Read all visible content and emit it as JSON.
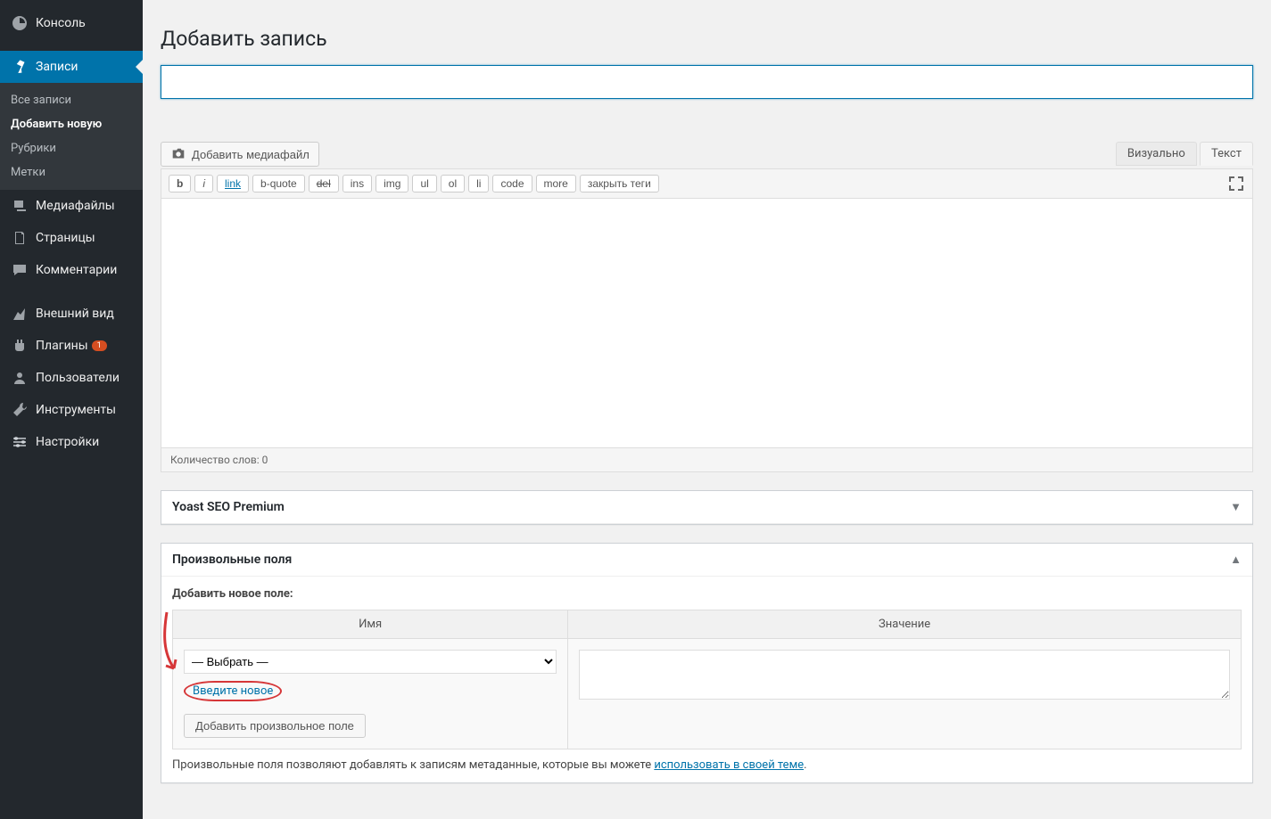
{
  "sidebar": {
    "console": "Консоль",
    "posts": "Записи",
    "posts_sub": {
      "all": "Все записи",
      "add": "Добавить новую",
      "categories": "Рубрики",
      "tags": "Метки"
    },
    "media": "Медиафайлы",
    "pages": "Страницы",
    "comments": "Комментарии",
    "appearance": "Внешний вид",
    "plugins": "Плагины",
    "plugins_badge": "1",
    "users": "Пользователи",
    "tools": "Инструменты",
    "settings": "Настройки"
  },
  "page": {
    "title": "Добавить запись",
    "add_media": "Добавить медиафайл"
  },
  "tabs": {
    "visual": "Визуально",
    "text": "Текст"
  },
  "toolbar": {
    "b": "b",
    "i": "i",
    "link": "link",
    "bquote": "b-quote",
    "del": "del",
    "ins": "ins",
    "img": "img",
    "ul": "ul",
    "ol": "ol",
    "li": "li",
    "code": "code",
    "more": "more",
    "close": "закрыть теги"
  },
  "editor": {
    "word_count": "Количество слов: 0"
  },
  "yoast": {
    "title": "Yoast SEO Premium"
  },
  "custom_fields": {
    "title": "Произвольные поля",
    "add_label": "Добавить новое поле:",
    "name_header": "Имя",
    "value_header": "Значение",
    "select_placeholder": "— Выбрать —",
    "enter_new": "Введите новое",
    "add_button": "Добавить произвольное поле",
    "note_prefix": "Произвольные поля позволяют добавлять к записям метаданные, которые вы можете ",
    "note_link": "использовать в своей теме",
    "note_suffix": "."
  }
}
